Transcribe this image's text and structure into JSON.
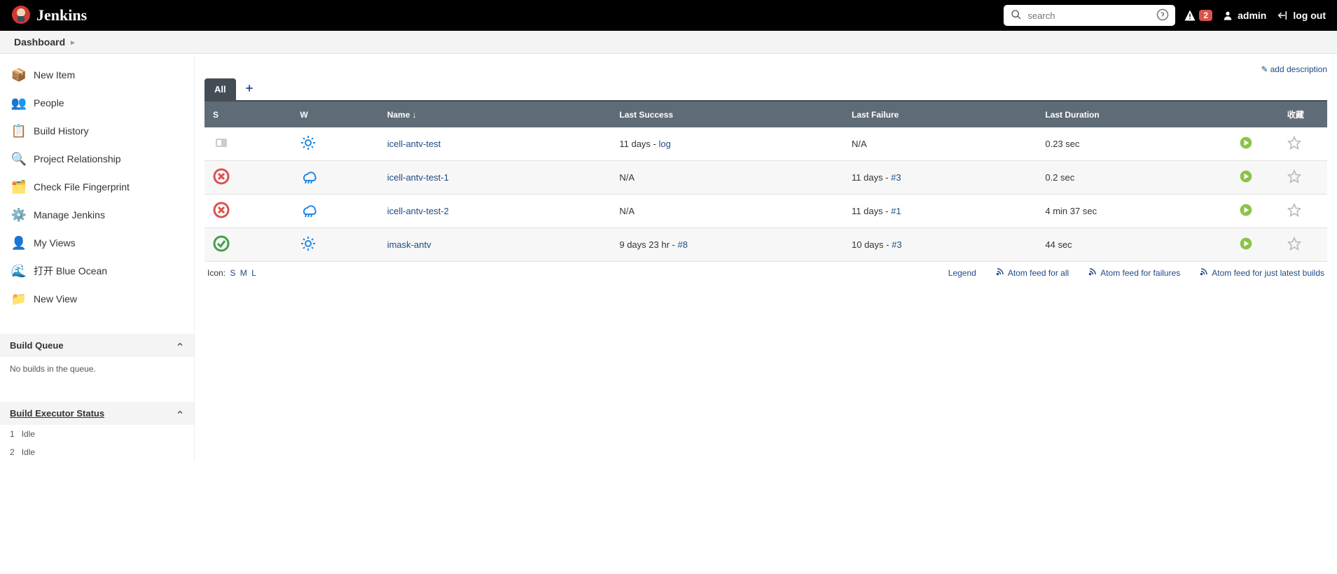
{
  "header": {
    "brand": "Jenkins",
    "search_placeholder": "search",
    "alert_count": "2",
    "username": "admin",
    "logout_label": "log out"
  },
  "breadcrumb": {
    "items": [
      "Dashboard"
    ]
  },
  "sidebar": {
    "items": [
      {
        "label": "New Item",
        "icon": "📦"
      },
      {
        "label": "People",
        "icon": "👥"
      },
      {
        "label": "Build History",
        "icon": "📋"
      },
      {
        "label": "Project Relationship",
        "icon": "🔍"
      },
      {
        "label": "Check File Fingerprint",
        "icon": "🗂️"
      },
      {
        "label": "Manage Jenkins",
        "icon": "⚙️"
      },
      {
        "label": "My Views",
        "icon": "👤"
      },
      {
        "label": "打开 Blue Ocean",
        "icon": "🌊"
      },
      {
        "label": "New View",
        "icon": "📁"
      }
    ],
    "build_queue": {
      "title": "Build Queue",
      "empty_text": "No builds in the queue."
    },
    "executor_status": {
      "title": "Build Executor Status",
      "executors": [
        {
          "num": "1",
          "state": "Idle"
        },
        {
          "num": "2",
          "state": "Idle"
        }
      ]
    }
  },
  "main": {
    "add_description": "add description",
    "active_tab": "All",
    "columns": {
      "status": "S",
      "weather": "W",
      "name": "Name ↓",
      "last_success": "Last Success",
      "last_failure": "Last Failure",
      "last_duration": "Last Duration",
      "favorite": "收藏"
    },
    "jobs": [
      {
        "status": "grey",
        "weather": "sun",
        "name": "icell-antv-test",
        "ls_text": "11 days - ",
        "ls_link": "log",
        "lf_text": "N/A",
        "lf_link": "",
        "duration": "0.23 sec"
      },
      {
        "status": "red",
        "weather": "rain",
        "name": "icell-antv-test-1",
        "ls_text": "N/A",
        "ls_link": "",
        "lf_text": "11 days - ",
        "lf_link": "#3",
        "duration": "0.2 sec"
      },
      {
        "status": "red",
        "weather": "rain",
        "name": "icell-antv-test-2",
        "ls_text": "N/A",
        "ls_link": "",
        "lf_text": "11 days - ",
        "lf_link": "#1",
        "duration": "4 min 37 sec"
      },
      {
        "status": "blue",
        "weather": "sun",
        "name": "imask-antv",
        "ls_text": "9 days 23 hr - ",
        "ls_link": "#8",
        "lf_text": "10 days - ",
        "lf_link": "#3",
        "duration": "44 sec"
      }
    ],
    "footer": {
      "icon_label": "Icon:",
      "sizes": [
        "S",
        "M",
        "L"
      ],
      "legend": "Legend",
      "feed_all": "Atom feed for all",
      "feed_failures": "Atom feed for failures",
      "feed_latest": "Atom feed for just latest builds"
    }
  }
}
